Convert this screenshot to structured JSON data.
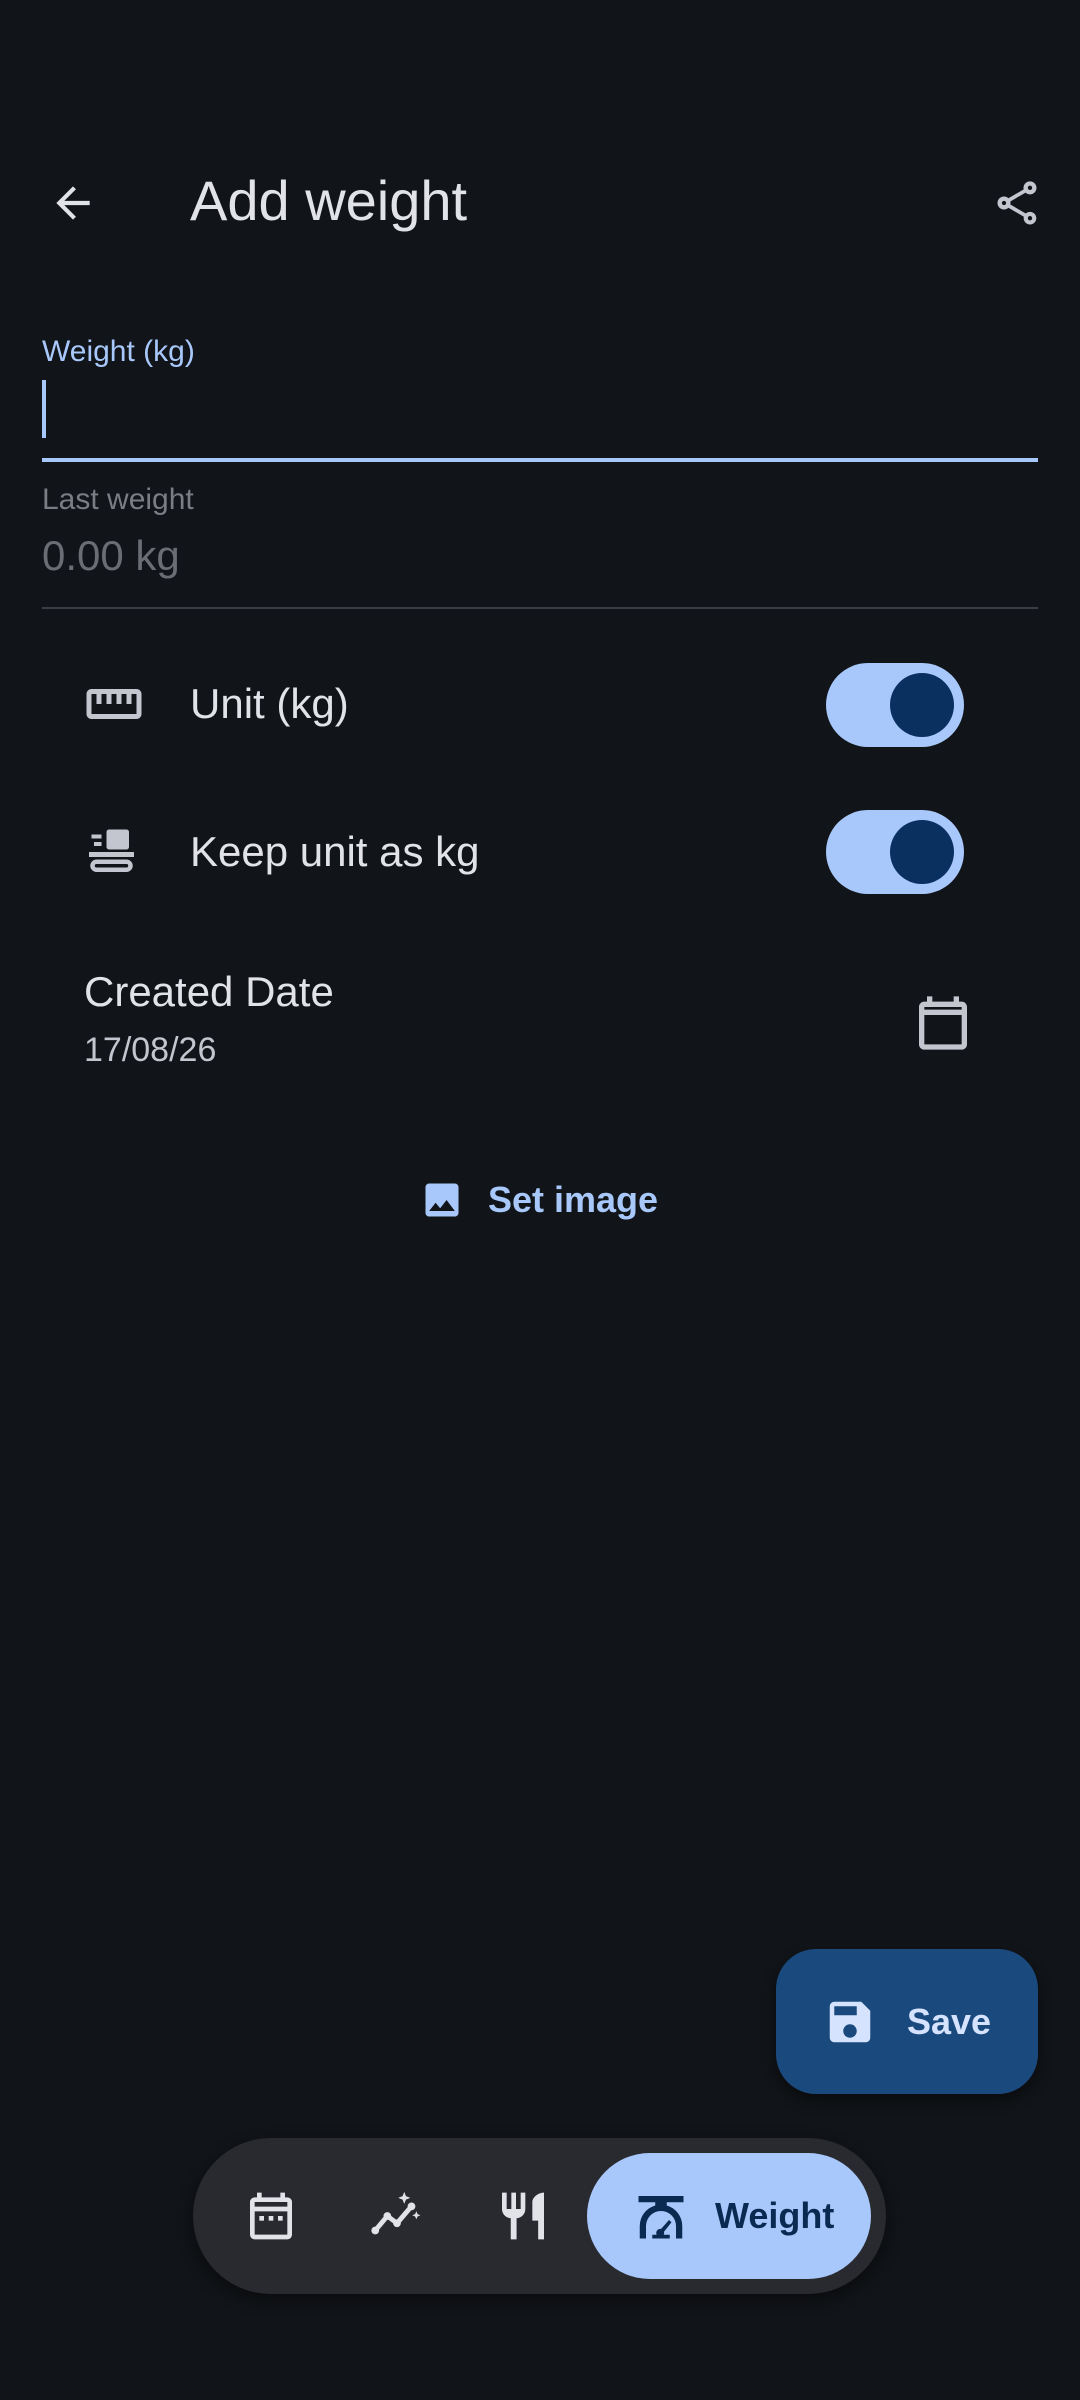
{
  "app_bar": {
    "title": "Add weight"
  },
  "weight_field": {
    "label": "Weight (kg)",
    "value": "",
    "placeholder": ""
  },
  "last_weight": {
    "label": "Last weight",
    "value": "0.00 kg"
  },
  "settings": {
    "unit": {
      "label": "Unit (kg)",
      "on": true
    },
    "keep_unit": {
      "label": "Keep unit as kg",
      "on": true
    }
  },
  "created_date": {
    "title": "Created Date",
    "value": "17/08/26"
  },
  "set_image": {
    "label": "Set image"
  },
  "fab": {
    "label": "Save"
  },
  "bottom_nav": {
    "active_label": "Weight"
  },
  "colors": {
    "background": "#111418",
    "accent": "#a8c8fb",
    "fab": "#1a4a7d",
    "nav_bar": "#282a2f"
  },
  "icons": {
    "back": "arrow-back-icon",
    "share": "share-icon",
    "unit": "ruler-icon",
    "keep_unit": "scale-transfer-icon",
    "calendar": "calendar-icon",
    "image": "image-icon",
    "save": "save-icon",
    "nav": [
      "calendar-month-icon",
      "chart-sparkle-icon",
      "restaurant-icon",
      "scale-icon"
    ]
  }
}
